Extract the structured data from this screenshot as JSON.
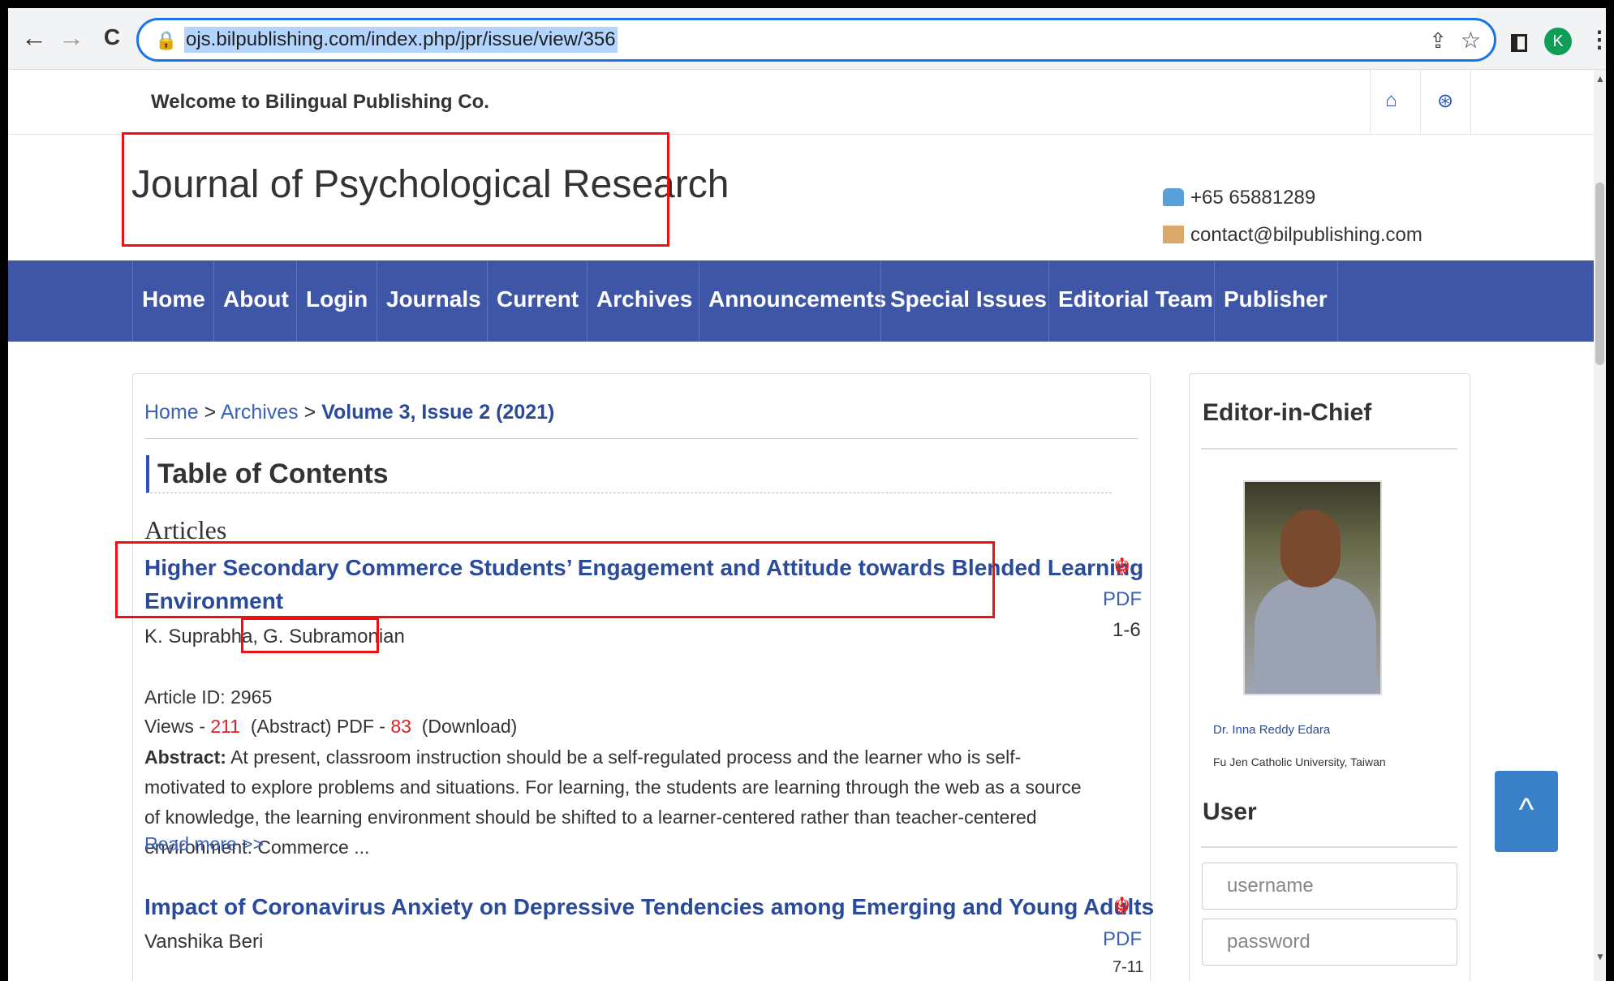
{
  "browser": {
    "back": "←",
    "forward": "→",
    "reload": "C",
    "url": "ojs.bilpublishing.com/index.php/jpr/issue/view/356",
    "avatar": "K",
    "menu": "⋮"
  },
  "topbar": {
    "welcome": "Welcome to Bilingual Publishing Co.",
    "home_icon": "⌂",
    "globe_icon": "⊛"
  },
  "header": {
    "journal_title": "Journal of Psychological Research",
    "phone": "+65 65881289",
    "email": "contact@bilpublishing.com"
  },
  "nav": {
    "items": [
      {
        "label": "Home"
      },
      {
        "label": "About"
      },
      {
        "label": "Login"
      },
      {
        "label": "Journals"
      },
      {
        "label": "Current"
      },
      {
        "label": "Archives"
      },
      {
        "label": "Announcements"
      },
      {
        "label": "Special Issues"
      },
      {
        "label": "Editorial Team"
      },
      {
        "label": "Publisher"
      }
    ]
  },
  "breadcrumb": {
    "home": "Home",
    "sep": " > ",
    "archives": "Archives",
    "current": "Volume 3, Issue 2 (2021)"
  },
  "toc": {
    "title": "Table of Contents",
    "section": "Articles"
  },
  "articles": [
    {
      "title_line1": "Higher Secondary Commerce Students’ Engagement and Attitude towards Blended Learning",
      "title_line2": "Environment",
      "author1": "K. Suprabha,",
      "author2": "G. Subramonian",
      "pdf": "PDF",
      "pages": "1-6",
      "article_id": "Article ID: 2965",
      "views_label": "Views - ",
      "views": "211",
      "abstract_views_label": "(Abstract) PDF - ",
      "downloads": "83",
      "download_label": "(Download)",
      "abstract_label": "Abstract:",
      "abstract_text": " At present, classroom instruction should be a self-regulated process and the learner who is self-motivated to explore problems and situations. For learning, the students are learning through the web as a source of knowledge, the learning environment should be shifted to a learner-centered rather than teacher-centered environment. Commerce ...",
      "read_more": "Read more >>"
    },
    {
      "title_line1": "Impact of Coronavirus Anxiety on Depressive Tendencies among Emerging and Young Adults",
      "author1": "Vanshika Beri",
      "pdf": "PDF",
      "pages": "7-11"
    }
  ],
  "sidebar": {
    "editor_heading": "Editor-in-Chief",
    "editor_name": "Dr. Inna Reddy Edara",
    "editor_affiliation": "Fu Jen Catholic University, Taiwan",
    "user_heading": "User",
    "username_placeholder": "username",
    "password_placeholder": "password"
  },
  "to_top": "^",
  "colors": {
    "nav_bg": "#3e56a5",
    "link": "#2a4a9a",
    "highlight_box": "#e11111",
    "accent_red": "#e02020"
  }
}
